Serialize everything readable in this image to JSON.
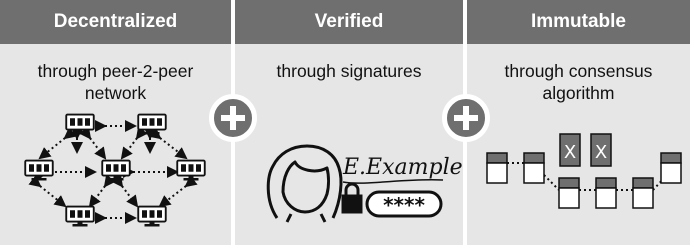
{
  "panels": [
    {
      "title": "Decentralized",
      "lines": [
        "through peer-2-peer",
        "network"
      ]
    },
    {
      "title": "Verified",
      "lines": [
        "through signatures",
        ""
      ]
    },
    {
      "title": "Immutable",
      "lines": [
        "through consensus",
        "algorithm"
      ]
    }
  ],
  "connectors": [
    "plus-icon",
    "plus-icon"
  ],
  "verified": {
    "signature": "E.Example",
    "password_mask": "****"
  },
  "immutable": {
    "rejected_mark": "X"
  },
  "colors": {
    "panel_bg": "#e6e6e6",
    "header_bg": "#6f6f6f",
    "header_text": "#ffffff",
    "line": "#111111"
  }
}
